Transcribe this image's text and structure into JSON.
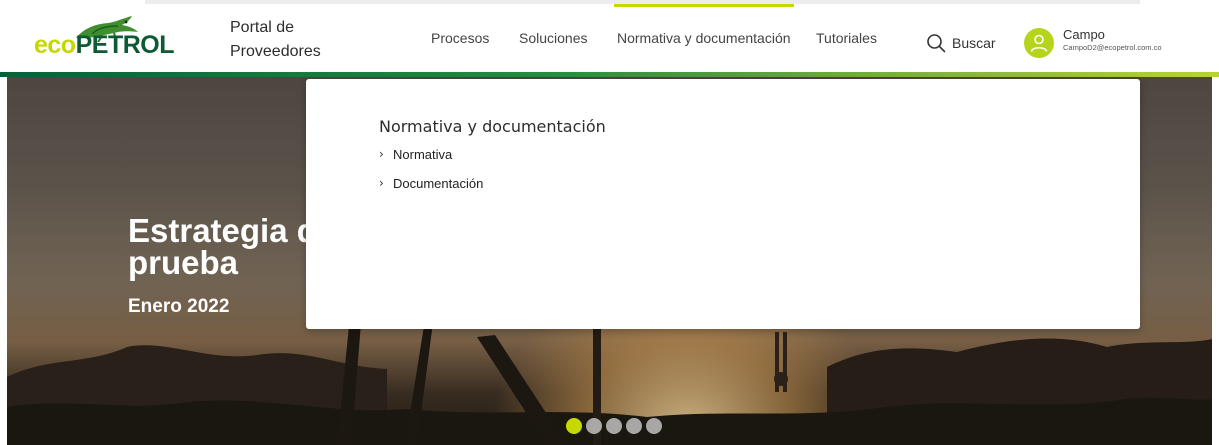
{
  "brand": {
    "logo_eco": "eco",
    "logo_petrol": "PETROL",
    "portal_title": "Portal de Proveedores",
    "colors": {
      "lime": "#c5d800",
      "green": "#0e5a35",
      "avatar": "#b6d41b"
    }
  },
  "nav": {
    "items": [
      {
        "label": "Procesos"
      },
      {
        "label": "Soluciones"
      },
      {
        "label": "Normativa y documentación",
        "active": true
      },
      {
        "label": "Tutoriales"
      }
    ]
  },
  "search": {
    "icon": "search-icon",
    "label": "Buscar"
  },
  "user": {
    "icon": "user-icon",
    "name": "Campo",
    "email": "CampoD2@ecopetrol.com.co"
  },
  "mega_menu": {
    "heading": "Normativa y documentación",
    "links": [
      {
        "icon": "chevron-right-icon",
        "label": "Normativa"
      },
      {
        "icon": "chevron-right-icon",
        "label": "Documentación"
      }
    ]
  },
  "hero": {
    "title": "Estrategia de prueba",
    "date": "Enero 2022",
    "slides": 5,
    "active_slide": 1
  }
}
